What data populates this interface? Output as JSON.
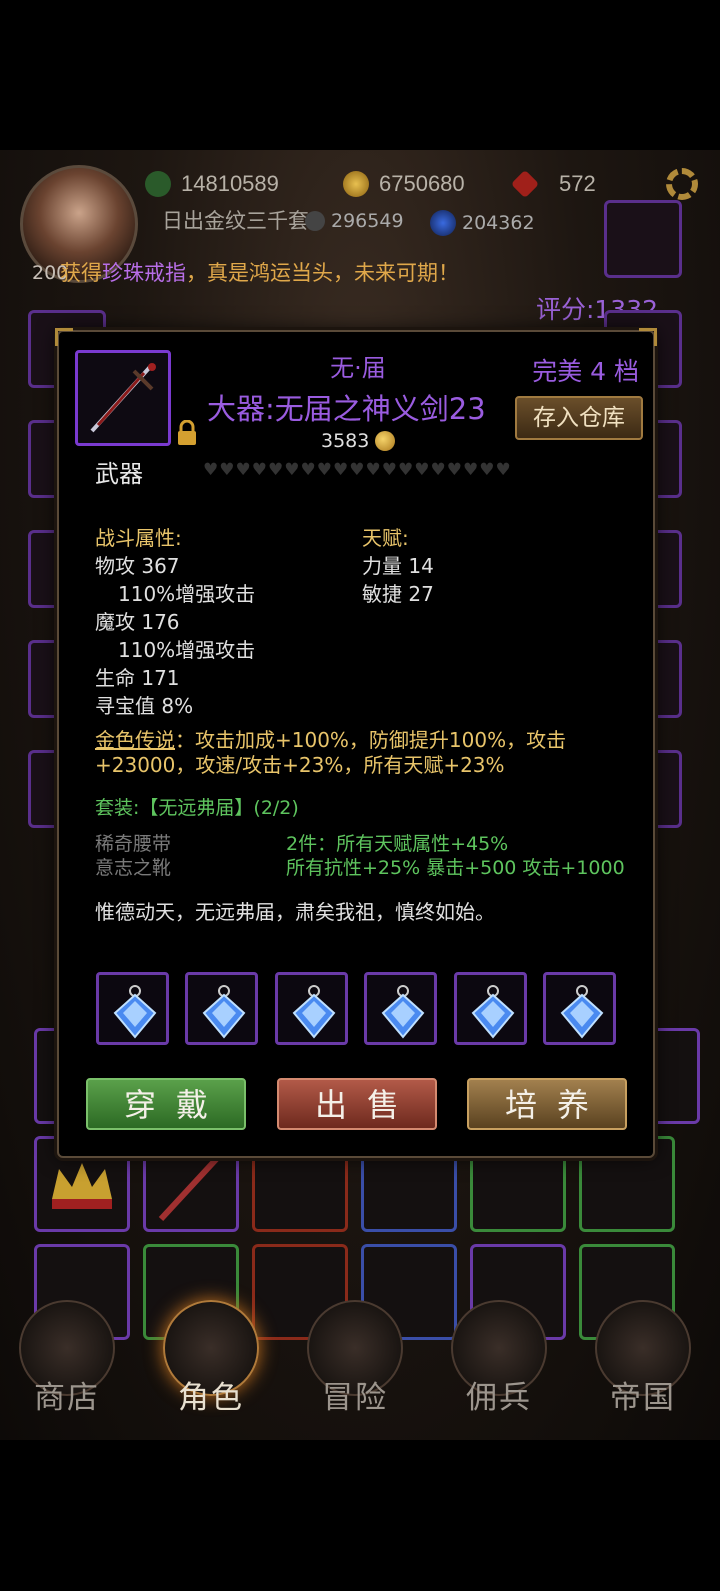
{
  "header": {
    "resource1": "14810589",
    "resource2": "6750680",
    "resource3": "572",
    "resource4": "296549",
    "resource5": "204362",
    "player_name": "日出金纹三千套",
    "level": "200",
    "marquee_prefix": "获得",
    "marquee_item": "珍珠戒指",
    "marquee_suffix": "，真是鸿运当头，未来可期！",
    "score": "评分:1332"
  },
  "item": {
    "name_top": "无·届",
    "full_name": "大器:无届之神义剑23",
    "price": "3583",
    "type": "武器",
    "grade": "完美 4 档",
    "store_label": "存入仓库",
    "hearts_count": 19
  },
  "stats": {
    "combat_title": "战斗属性:",
    "talent_title": "天赋:",
    "combat": [
      "物攻 367",
      "110%增强攻击",
      "魔攻 176",
      "110%增强攻击",
      "生命 171",
      "寻宝值 8%"
    ],
    "talent": [
      "力量 14",
      "敏捷 27"
    ]
  },
  "legend": {
    "label": "金色传说",
    "text": "：攻击加成+100%，防御提升100%，攻击+23000，攻速/攻击+23%，所有天赋+23%"
  },
  "set": {
    "title": "套装:【无远弗届】(2/2)",
    "pieces": [
      "稀奇腰带",
      "意志之靴"
    ],
    "bonuses": [
      "2件：所有天赋属性+45%",
      "所有抗性+25% 暴击+500 攻击+1000"
    ]
  },
  "flavor": "惟德动天，无远弗届，肃矣我祖，慎终如始。",
  "actions": {
    "equip": "穿戴",
    "sell": "出售",
    "train": "培养"
  },
  "nav": [
    "商店",
    "角色",
    "冒险",
    "佣兵",
    "帝国"
  ],
  "colors": {
    "rarity_purple": "#9a5ce0",
    "legend_gold": "#e8c46a",
    "set_green": "#5ec45e"
  }
}
